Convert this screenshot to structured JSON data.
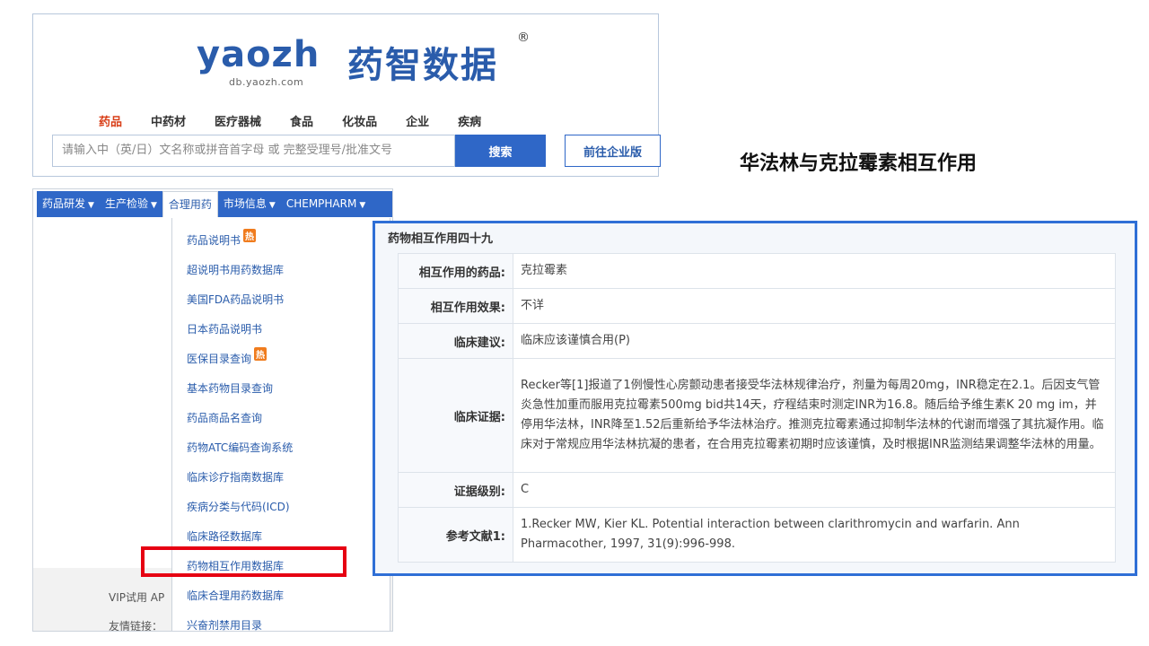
{
  "logo": {
    "latin": "yaozh",
    "sub": "db.yaozh.com",
    "cn": "药智数据",
    "reg": "®"
  },
  "categories": [
    "药品",
    "中药材",
    "医疗器械",
    "食品",
    "化妆品",
    "企业",
    "疾病"
  ],
  "search": {
    "placeholder": "请输入中（英/日）文名称或拼音首字母  或  完整受理号/批准文号",
    "button": "搜索",
    "enterprise_button": "前往企业版"
  },
  "slide_title": "华法林与克拉霉素相互作用",
  "navbar": {
    "items": [
      {
        "label": "药品研发",
        "caret": "▼"
      },
      {
        "label": "生产检验",
        "caret": "▼"
      },
      {
        "label": "合理用药",
        "caret": ""
      },
      {
        "label": "市场信息",
        "caret": "▼"
      },
      {
        "label": "CHEMPHARM",
        "caret": "▼"
      }
    ]
  },
  "dropdown": {
    "items": [
      {
        "label": "药品说明书",
        "hot": "热"
      },
      {
        "label": "超说明书用药数据库",
        "hot": ""
      },
      {
        "label": "美国FDA药品说明书",
        "hot": ""
      },
      {
        "label": "日本药品说明书",
        "hot": ""
      },
      {
        "label": "医保目录查询",
        "hot": "热"
      },
      {
        "label": "基本药物目录查询",
        "hot": ""
      },
      {
        "label": "药品商品名查询",
        "hot": ""
      },
      {
        "label": "药物ATC编码查询系统",
        "hot": ""
      },
      {
        "label": "临床诊疗指南数据库",
        "hot": ""
      },
      {
        "label": "疾病分类与代码(ICD)",
        "hot": ""
      },
      {
        "label": "临床路径数据库",
        "hot": ""
      },
      {
        "label": "药物相互作用数据库",
        "hot": ""
      },
      {
        "label": "临床合理用药数据库",
        "hot": ""
      },
      {
        "label": "兴奋剂禁用目录",
        "hot": ""
      }
    ]
  },
  "footer": {
    "line1": "VIP试用   AP",
    "line2": "友情链接："
  },
  "info": {
    "title": "药物相互作用四十九",
    "rows": [
      {
        "key": "相互作用的药品:",
        "value": "克拉霉素"
      },
      {
        "key": "相互作用效果:",
        "value": "不详"
      },
      {
        "key": "临床建议:",
        "value": "临床应该谨慎合用(P)"
      },
      {
        "key": "临床证据:",
        "value": "Recker等[1]报道了1例慢性心房颤动患者接受华法林规律治疗，剂量为每周20mg，INR稳定在2.1。后因支气管炎急性加重而服用克拉霉素500mg bid共14天，疗程结束时测定INR为16.8。随后给予维生素K 20 mg im，并停用华法林，INR降至1.52后重新给予华法林治疗。推测克拉霉素通过抑制华法林的代谢而增强了其抗凝作用。临床对于常规应用华法林抗凝的患者，在合用克拉霉素初期时应该谨慎，及时根据INR监测结果调整华法林的用量。"
      },
      {
        "key": "证据级别:",
        "value": "C"
      },
      {
        "key": "参考文献1:",
        "value": "1.Recker MW, Kier KL. Potential interaction between clarithromycin and warfarin. Ann Pharmacother, 1997, 31(9):996-998."
      }
    ]
  }
}
